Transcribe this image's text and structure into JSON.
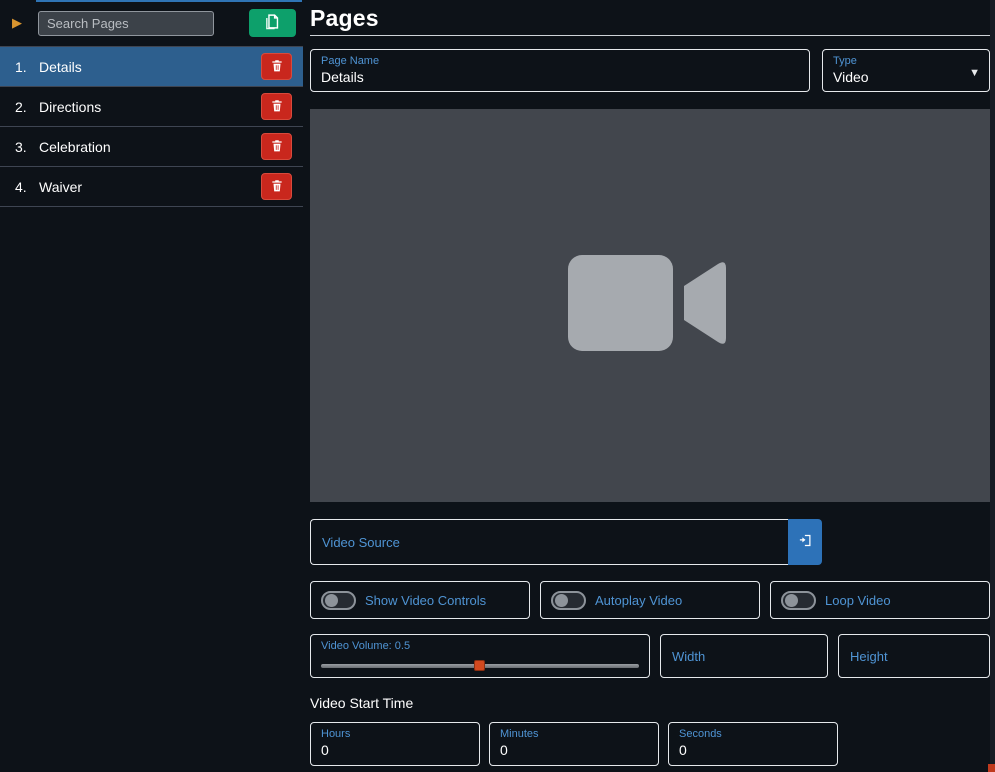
{
  "colors": {
    "accent_blue": "#4f94d4",
    "selected_item_blue": "#2d5f8e",
    "danger_red": "#c9271d",
    "success_green": "#0da06b",
    "slider_handle_orange": "#d2491f",
    "video_preview_gray": "#42464d"
  },
  "sidebar": {
    "search": {
      "placeholder": "Search Pages"
    },
    "pages": [
      {
        "number": "1.",
        "label": "Details",
        "selected": true
      },
      {
        "number": "2.",
        "label": "Directions",
        "selected": false
      },
      {
        "number": "3.",
        "label": "Celebration",
        "selected": false
      },
      {
        "number": "4.",
        "label": "Waiver",
        "selected": false
      }
    ]
  },
  "main": {
    "title": "Pages",
    "page_name": {
      "label": "Page Name",
      "value": "Details"
    },
    "type": {
      "label": "Type",
      "value": "Video"
    },
    "video_source": {
      "label": "Video Source",
      "value": ""
    },
    "toggles": [
      {
        "label": "Show Video Controls",
        "state": "off"
      },
      {
        "label": "Autoplay Video",
        "state": "off"
      },
      {
        "label": "Loop Video",
        "state": "off"
      }
    ],
    "volume": {
      "label": "Video Volume: 0.5",
      "value": 0.5
    },
    "width": {
      "label": "Width",
      "value": ""
    },
    "height": {
      "label": "Height",
      "value": ""
    },
    "start_time": {
      "label": "Video Start Time",
      "hours": {
        "label": "Hours",
        "value": "0"
      },
      "minutes": {
        "label": "Minutes",
        "value": "0"
      },
      "seconds": {
        "label": "Seconds",
        "value": "0"
      }
    }
  }
}
